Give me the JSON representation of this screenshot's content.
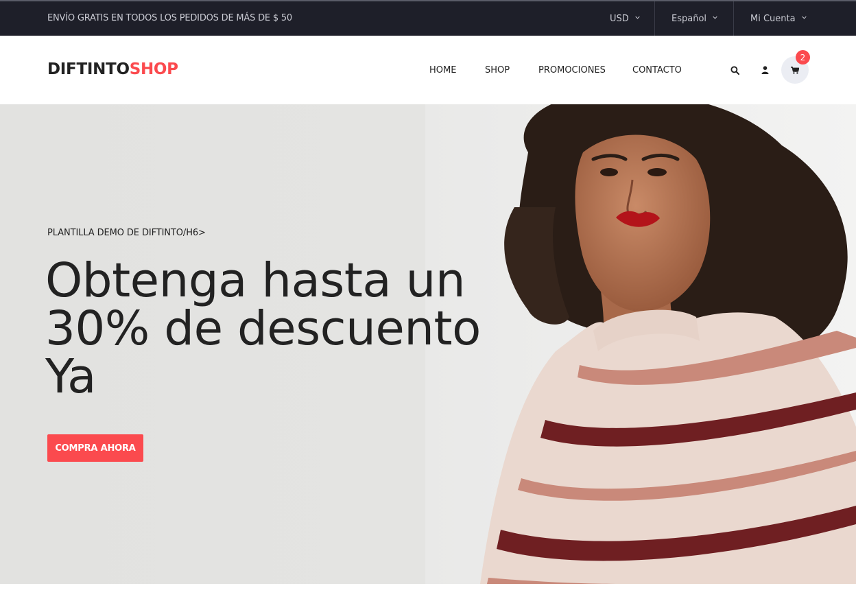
{
  "topbar": {
    "promo": "ENVÍO GRATIS EN TODOS LOS PEDIDOS DE MÁS DE $ 50",
    "currency": "USD",
    "language": "Español",
    "account": "Mi Cuenta"
  },
  "header": {
    "logo_part1": "DIFTINTO",
    "logo_part2": "SHOP",
    "nav": [
      "HOME",
      "SHOP",
      "PROMOCIONES",
      "CONTACTO"
    ],
    "cart_count": "2",
    "icons": [
      "search-icon",
      "user-icon",
      "cart-icon"
    ]
  },
  "hero": {
    "eyebrow": "PLANTILLA DEMO DE DIFTINTO/H6>",
    "headline_line1": "Obtenga hasta un",
    "headline_line2": "30% de descuento",
    "headline_line3": "Ya",
    "cta": "COMPRA AHORA"
  },
  "colors": {
    "accent": "#fb4a4e",
    "topbar_bg": "#1e1f29",
    "text": "#222222"
  }
}
